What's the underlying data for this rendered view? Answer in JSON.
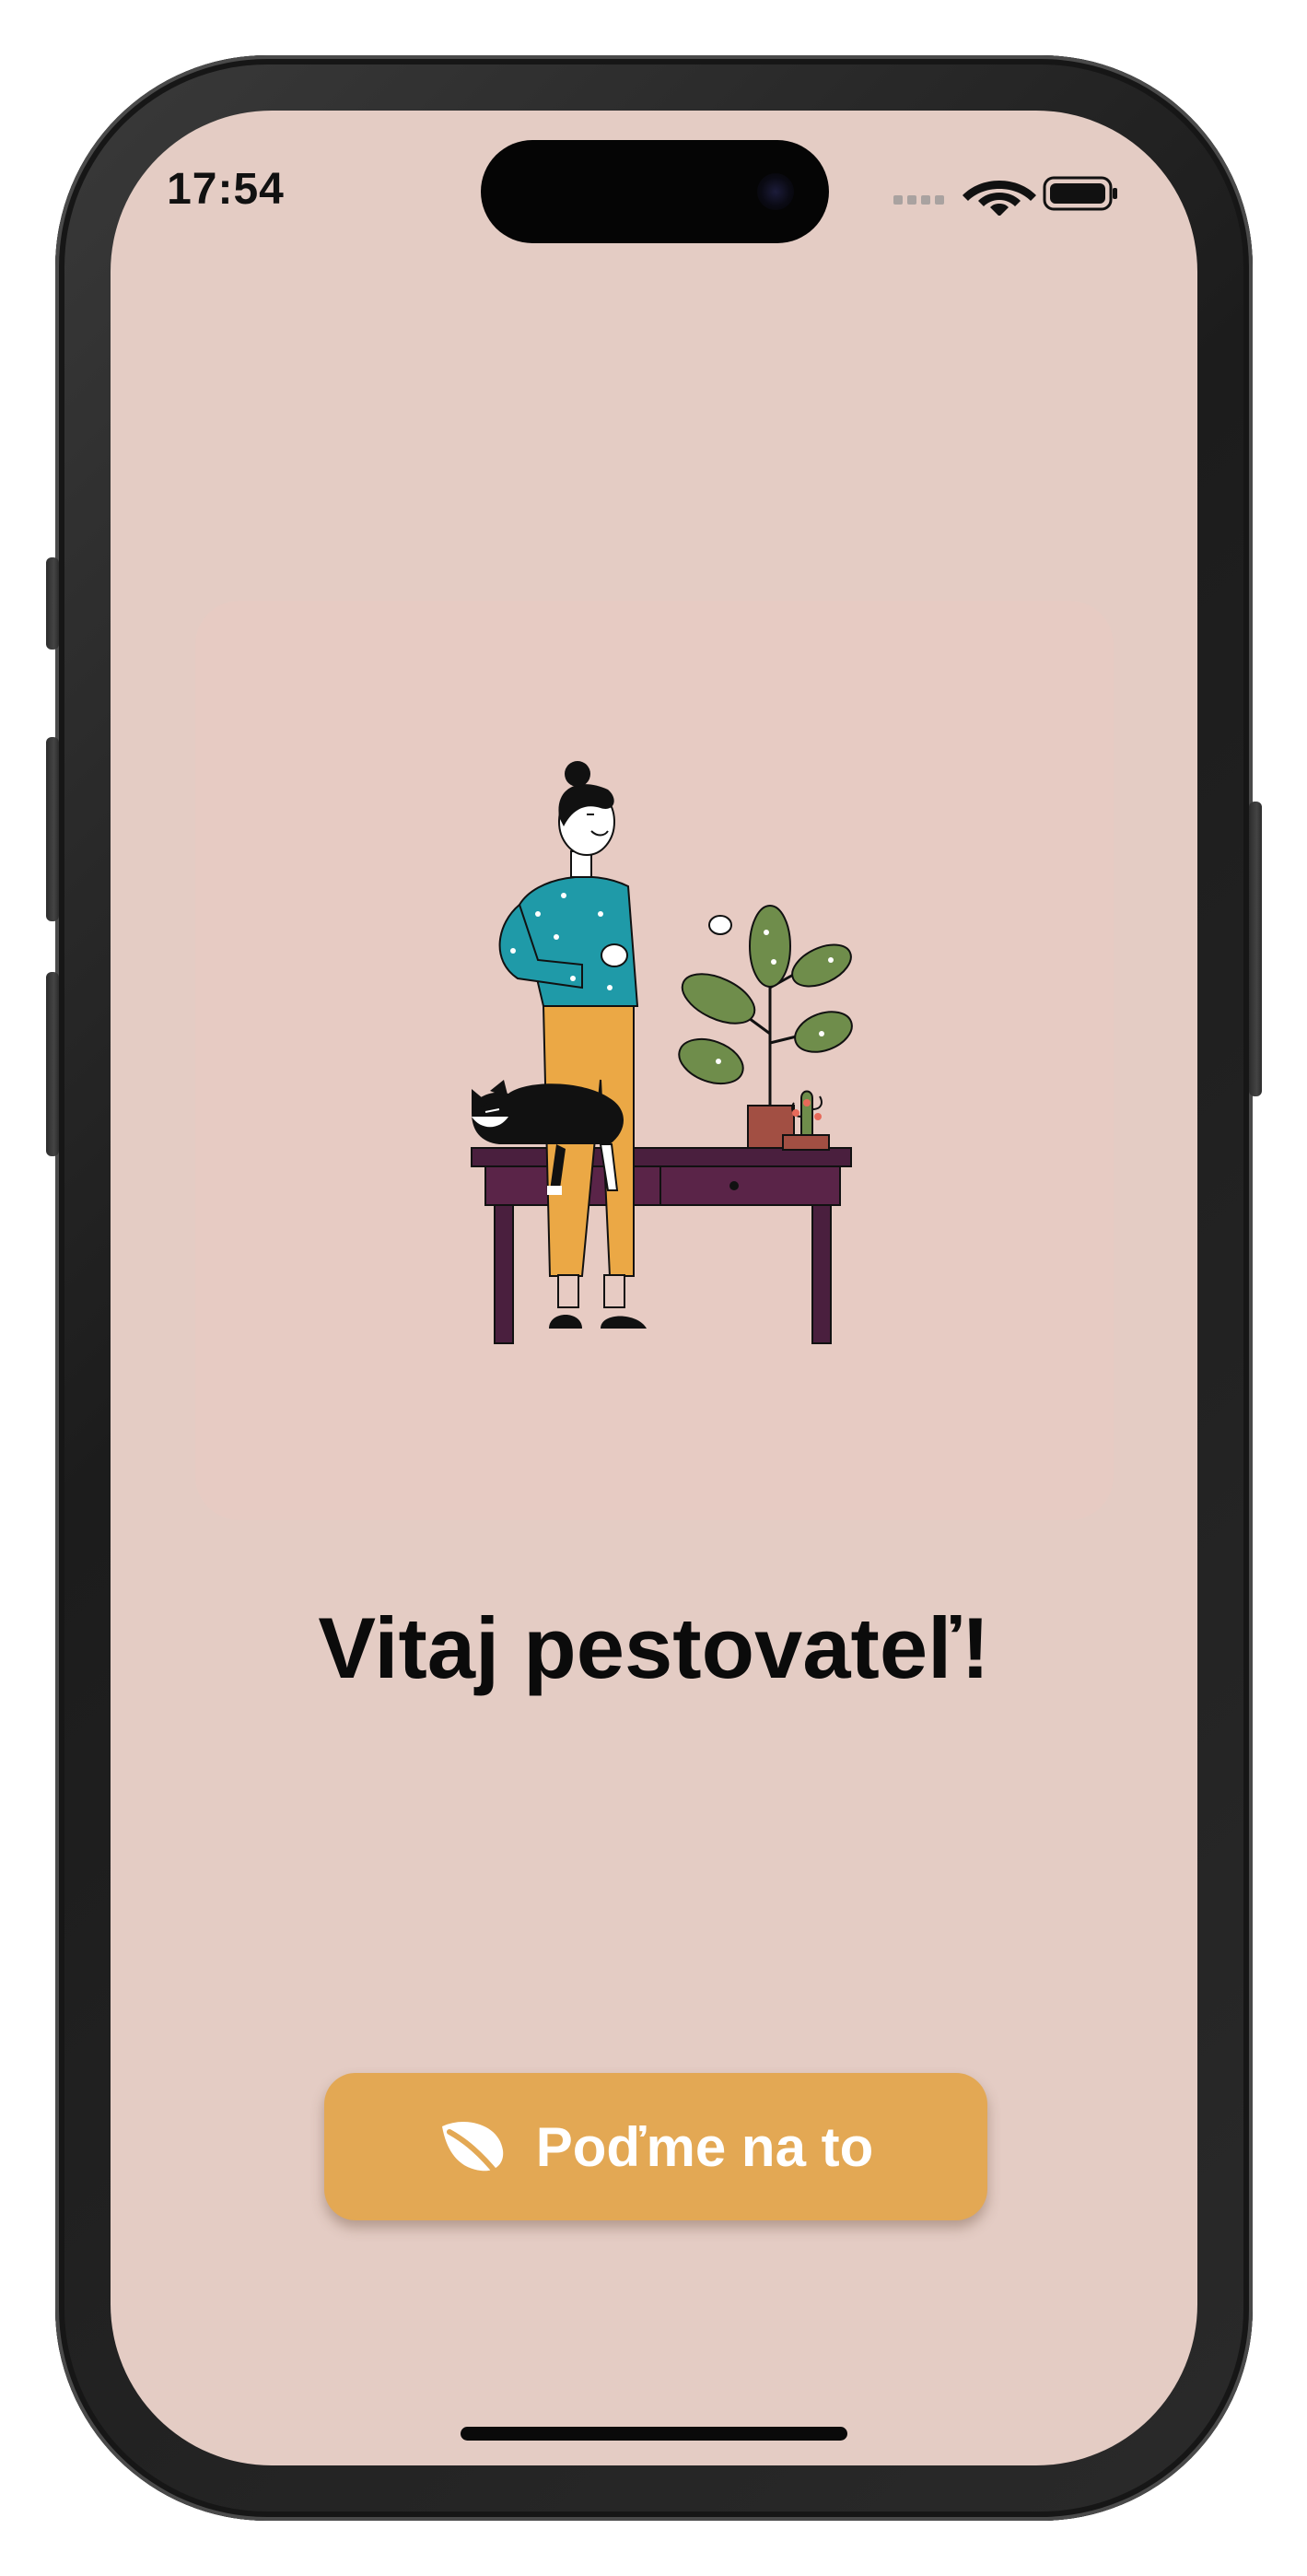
{
  "status_bar": {
    "time": "17:54",
    "cellular_icon": "cellular-signal-icon",
    "wifi_icon": "wifi-icon",
    "battery_icon": "battery-icon"
  },
  "onboarding": {
    "illustration": "woman-watering-plants-illustration",
    "title": "Vitaj pestovateľ!",
    "cta": {
      "label": "Poďme na to",
      "icon": "leaf-icon"
    }
  },
  "colors": {
    "background": "#e4ccc4",
    "card": "#e7cbc3",
    "cta_background": "#e3a854",
    "cta_text": "#ffffff",
    "title_text": "#0b0b0b"
  }
}
